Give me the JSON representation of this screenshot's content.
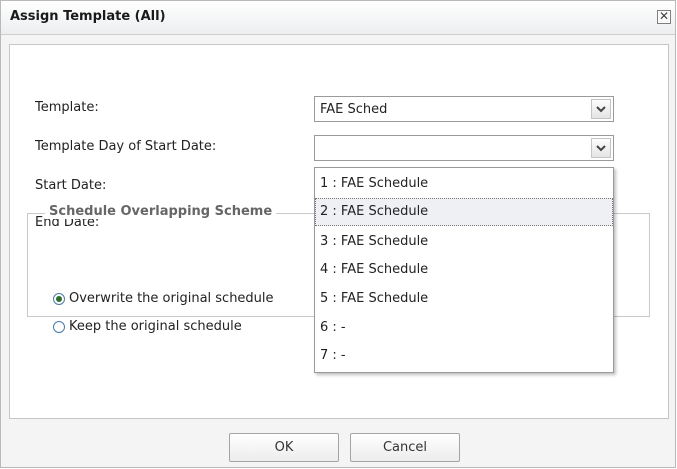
{
  "dialog": {
    "title": "Assign Template (All)",
    "close_symbol": "✕"
  },
  "form": {
    "template_label": "Template:",
    "template_value": "FAE Sched",
    "day_label": "Template Day of Start Date:",
    "day_value": "",
    "start_label": "Start Date:",
    "end_label": "End Date:"
  },
  "overlap": {
    "legend": "Schedule Overlapping Scheme",
    "options": [
      {
        "label": "Overwrite the original schedule",
        "selected": true
      },
      {
        "label": "Keep the original schedule",
        "selected": false
      }
    ]
  },
  "dropdown": {
    "highlighted_index": 1,
    "options": [
      "1 : FAE Schedule",
      "2 : FAE Schedule",
      "3 : FAE Schedule",
      "4 : FAE Schedule",
      "5 : FAE Schedule",
      "6 : -",
      "7 : -"
    ]
  },
  "buttons": {
    "ok": "OK",
    "cancel": "Cancel"
  },
  "icons": {
    "dropdown_arrow": "chevron-down-icon",
    "close": "close-icon"
  }
}
